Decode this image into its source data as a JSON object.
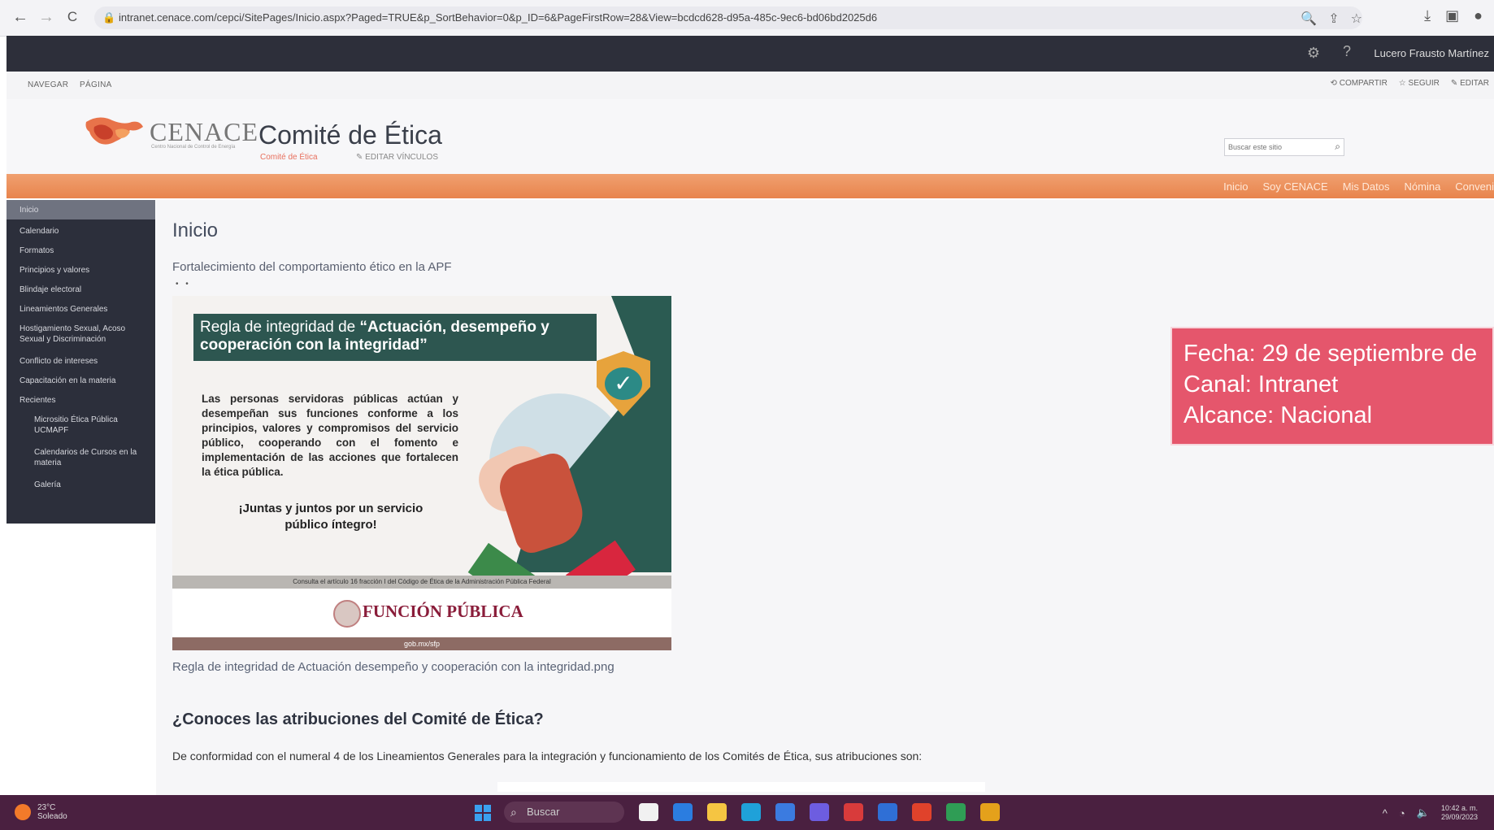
{
  "browser": {
    "url": "intranet.cenace.com/cepci/SitePages/Inicio.aspx?Paged=TRUE&p_SortBehavior=0&p_ID=6&PageFirstRow=28&View=bcdcd628-d95a-485c-9ec6-bd06bd2025d6",
    "back": "←",
    "forward": "→",
    "reload": "C"
  },
  "suite_bar": {
    "user": "Lucero Frausto Martínez",
    "help": "?"
  },
  "ribbon": {
    "tabs": [
      "NAVEGAR",
      "PÁGINA"
    ],
    "actions": [
      "COMPARTIR",
      "SEGUIR",
      "EDITAR"
    ]
  },
  "header": {
    "logo_text": "CENACE",
    "logo_sub": "Centro Nacional de Control de Energía",
    "site_title": "Comité de Ética",
    "breadcrumb": "Comité de Ética",
    "edit_links": "EDITAR VÍNCULOS",
    "search_placeholder": "Buscar este sitio"
  },
  "top_nav": [
    "Inicio",
    "Soy CENACE",
    "Mis Datos",
    "Nómina",
    "Conveni"
  ],
  "left_nav": {
    "selected": "Inicio",
    "items": [
      "Calendario",
      "Formatos",
      "Principios y valores",
      "Blindaje electoral",
      "Lineamientos Generales",
      "Hostigamiento Sexual, Acoso Sexual y Discriminación",
      "Conflicto de intereses",
      "Capacitación en la materia",
      "Recientes"
    ],
    "sub_items": [
      "Micrositio Ética Pública UCMAPF",
      "Calendarios de Cursos en la materia",
      "Galería"
    ]
  },
  "main": {
    "title": "Inicio",
    "subtitle": "Fortalecimiento del comportamiento ético en la APF",
    "dots": "• •",
    "poster": {
      "banner_prefix": "Regla de integridad de ",
      "banner_bold": "“Actuación, desempeño y cooperación con la integridad”",
      "body": "Las personas servidoras públicas actúan y desempeñan sus funciones conforme a los principios, valores y compromisos del servicio público, cooperando con el fomento e implementación de las acciones que fortalecen la ética pública.",
      "slogan": "¡Juntas y juntos por un servicio público íntegro!",
      "footer_note": "Consulta el artículo 16 fracción I del Código de Ética de la Administración Pública Federal",
      "brand": "FUNCIÓN PÚBLICA",
      "bottom_bar": "gob.mx/sfp"
    },
    "image_caption": "Regla de integridad de Actuación desempeño y cooperación con la integridad.png",
    "section_heading": "¿Conoces las atribuciones del Comité de Ética?",
    "section_text": "De conformidad con el numeral 4 de los Lineamientos Generales para la integración y funcionamiento de los Comités de Ética, sus atribuciones son:"
  },
  "fecha_box": {
    "line1": "Fecha: 29 de septiembre de",
    "line2": "Canal: Intranet",
    "line3": "Alcance: Nacional"
  },
  "taskbar": {
    "weather_temp": "23°C",
    "weather_desc": "Soleado",
    "search": "Buscar",
    "time": "10:42 a. m.",
    "date": "29/09/2023",
    "app_colors": [
      "#f1f1f1",
      "#2b7de0",
      "#f5c542",
      "#1fa1d9",
      "#3b7be0",
      "#6d5de0",
      "#d83b3b",
      "#2f6fd6",
      "#e0422b",
      "#2f9d55",
      "#e4a11b"
    ]
  }
}
